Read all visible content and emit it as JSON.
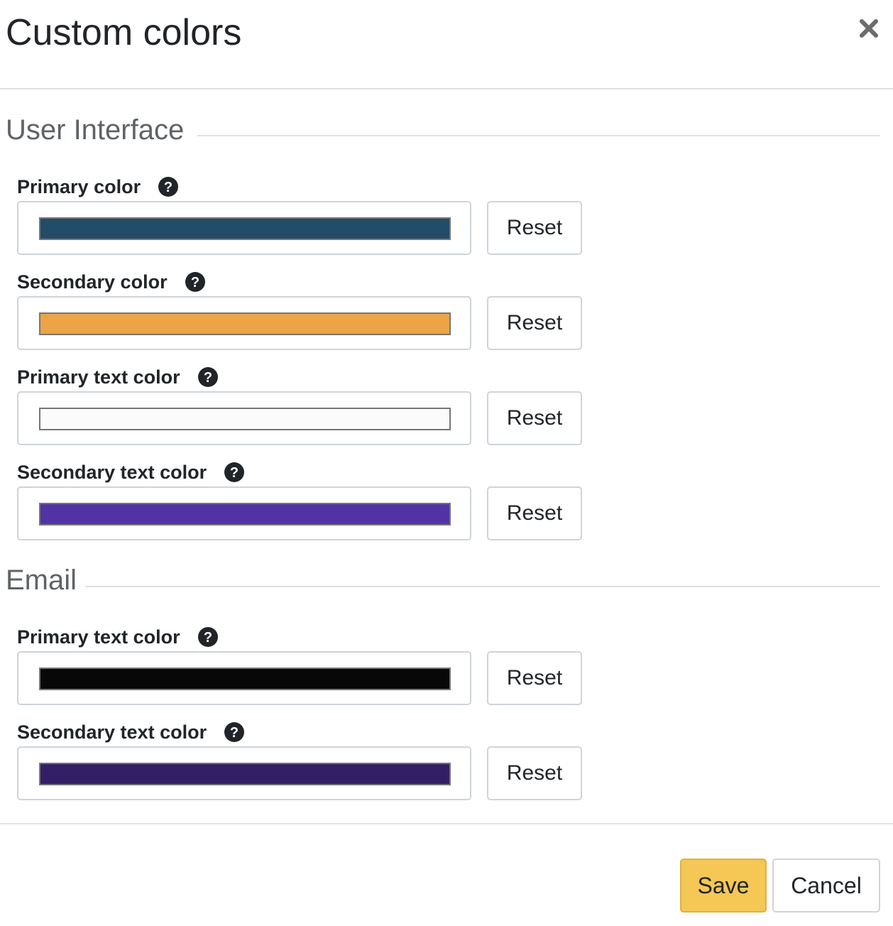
{
  "modal": {
    "title": "Custom colors"
  },
  "sections": [
    {
      "legend": "User Interface",
      "fields": [
        {
          "label": "Primary color",
          "color": "#234c69",
          "reset_label": "Reset"
        },
        {
          "label": "Secondary color",
          "color": "#eca446",
          "reset_label": "Reset"
        },
        {
          "label": "Primary text color",
          "color": "#fbfbfb",
          "reset_label": "Reset"
        },
        {
          "label": "Secondary text color",
          "color": "#5233a6",
          "reset_label": "Reset"
        }
      ]
    },
    {
      "legend": "Email",
      "fields": [
        {
          "label": "Primary text color",
          "color": "#080808",
          "reset_label": "Reset"
        },
        {
          "label": "Secondary text color",
          "color": "#331f66",
          "reset_label": "Reset"
        }
      ]
    }
  ],
  "footer": {
    "save_label": "Save",
    "cancel_label": "Cancel"
  },
  "icons": {
    "close": "close-icon",
    "help": "question-circle-icon"
  },
  "colors": {
    "save_button": "#f5c755",
    "border": "#dee2e6"
  }
}
